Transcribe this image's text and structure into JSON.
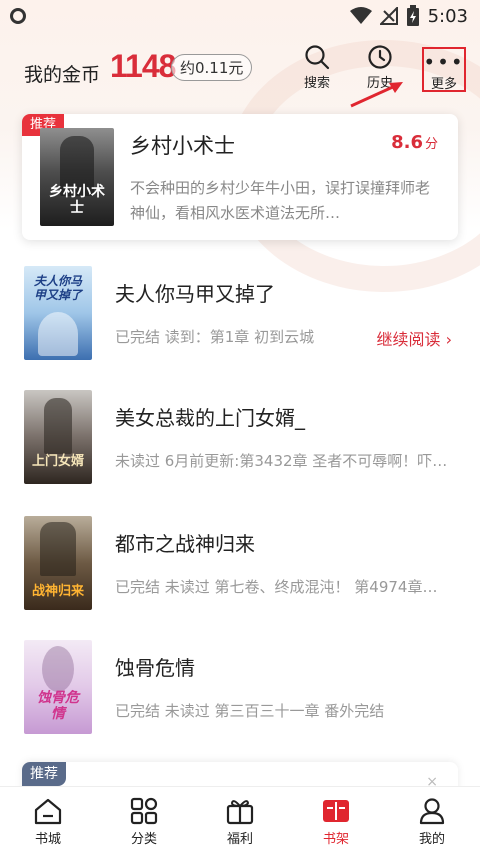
{
  "status_bar": {
    "time": "5:03"
  },
  "header": {
    "coin_label": "我的金币",
    "coin_value": "1148",
    "coin_approx": "约0.11元",
    "search_label": "搜索",
    "history_label": "历史",
    "more_label": "更多"
  },
  "featured": {
    "tag": "推荐",
    "title": "乡村小术士",
    "score": "8.6",
    "score_unit": "分",
    "description": "不会种田的乡村少年牛小田，误打误撞拜师老神仙，看相风水医术道法无所…",
    "cover_text": "乡村小术士"
  },
  "books": [
    {
      "title": "夫人你马甲又掉了",
      "meta": "已完结 读到：第1章 初到云城",
      "action": "继续阅读 ›",
      "cover_text": "夫人你马甲又掉了"
    },
    {
      "title": "美女总裁的上门女婿_",
      "meta": "未读过 6月前更新:第3432章 圣者不可辱啊！吓…",
      "cover_text": "上门女婿"
    },
    {
      "title": "都市之战神归来",
      "meta": "已完结 未读过 第七卷、终成混沌！ 第4974章…",
      "cover_text": "战神归来"
    },
    {
      "title": "蚀骨危情",
      "meta": "已完结 未读过 第三百三十一章  番外完结",
      "cover_text": "蚀骨危情"
    }
  ],
  "bottom_card": {
    "tag": "推荐",
    "close": "×"
  },
  "nav": [
    {
      "label": "书城",
      "icon": "home-icon"
    },
    {
      "label": "分类",
      "icon": "category-icon"
    },
    {
      "label": "福利",
      "icon": "gift-icon"
    },
    {
      "label": "书架",
      "icon": "bookshelf-icon",
      "active": true
    },
    {
      "label": "我的",
      "icon": "profile-icon"
    }
  ],
  "colors": {
    "accent": "#e0262f",
    "coin": "#d92d3a",
    "tag_secondary": "#5a6b8a"
  }
}
